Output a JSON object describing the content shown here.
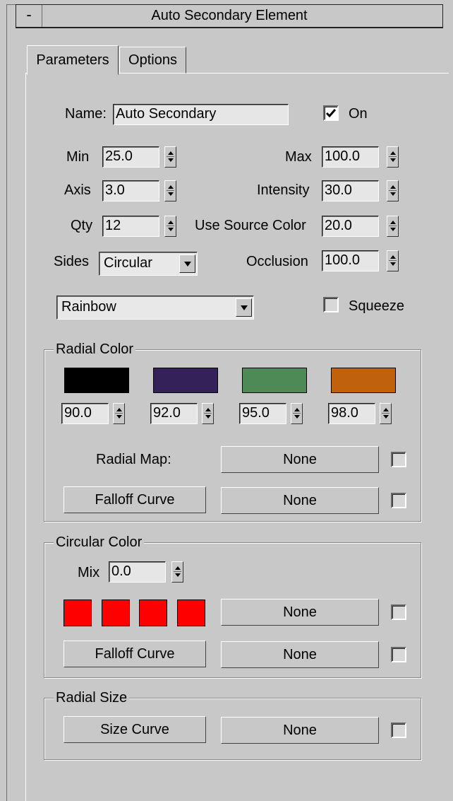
{
  "rollout": {
    "collapse_symbol": "-",
    "title": "Auto Secondary Element"
  },
  "tabs": [
    {
      "label": "Parameters",
      "active": true
    },
    {
      "label": "Options",
      "active": false
    }
  ],
  "name": {
    "label": "Name:",
    "value": "Auto Secondary"
  },
  "on": {
    "label": "On",
    "checked": true
  },
  "min": {
    "label": "Min",
    "value": "25.0"
  },
  "max": {
    "label": "Max",
    "value": "100.0"
  },
  "axis": {
    "label": "Axis",
    "value": "3.0"
  },
  "intensity": {
    "label": "Intensity",
    "value": "30.0"
  },
  "qty": {
    "label": "Qty",
    "value": "12"
  },
  "use_source_color": {
    "label": "Use Source Color",
    "value": "20.0"
  },
  "sides": {
    "label": "Sides",
    "value": "Circular"
  },
  "occlusion": {
    "label": "Occlusion",
    "value": "100.0"
  },
  "preset": {
    "value": "Rainbow"
  },
  "squeeze": {
    "label": "Squeeze",
    "checked": false
  },
  "radial_color": {
    "title": "Radial Color",
    "swatches": [
      {
        "color": "#000000",
        "value": "90.0"
      },
      {
        "color": "#35215a",
        "value": "92.0"
      },
      {
        "color": "#4e8a55",
        "value": "95.0"
      },
      {
        "color": "#c0620c",
        "value": "98.0"
      }
    ],
    "radial_map_label": "Radial Map:",
    "radial_map_button": "None",
    "falloff_button": "Falloff Curve",
    "falloff_map_button": "None"
  },
  "circular_color": {
    "title": "Circular Color",
    "mix_label": "Mix",
    "mix_value": "0.0",
    "swatch_color": "#ff0000",
    "map_button": "None",
    "falloff_button": "Falloff Curve",
    "falloff_map_button": "None"
  },
  "radial_size": {
    "title": "Radial Size",
    "size_curve_button": "Size Curve",
    "map_button": "None"
  }
}
